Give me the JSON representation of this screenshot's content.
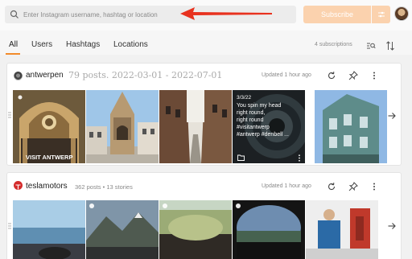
{
  "search": {
    "placeholder": "Enter Instagram username, hashtag or location"
  },
  "toolbar": {
    "subscribe_label": "Subscribe"
  },
  "tabs": [
    {
      "label": "All",
      "active": true
    },
    {
      "label": "Users",
      "active": false
    },
    {
      "label": "Hashtags",
      "active": false
    },
    {
      "label": "Locations",
      "active": false
    }
  ],
  "subscriptions": {
    "count_label": "4 subscriptions"
  },
  "accent_color": "#f28b2a",
  "feeds": [
    {
      "name": "antwerpen",
      "meta": "79 posts. 2022-03-01 - 2022-07-01",
      "updated": "Updated 1 hour ago",
      "photo_texts": {
        "visit": "VISIT ANTWERP",
        "date": "3/3/22",
        "caption": [
          "You spin my head",
          "right round,",
          "right round",
          "#visitantwerp",
          "#antwerp #denbell ..."
        ]
      }
    },
    {
      "name": "teslamotors",
      "meta": "362 posts • 13 stories",
      "updated": "Updated 1 hour ago"
    }
  ]
}
